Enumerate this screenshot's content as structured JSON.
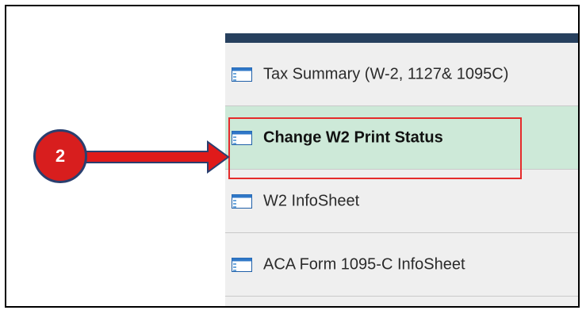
{
  "callout": {
    "step_number": "2"
  },
  "menu": {
    "items": [
      {
        "label": "Tax Summary (W-2, 1127& 1095C)",
        "icon": "page-list-icon",
        "selected": false
      },
      {
        "label": "Change W2 Print Status",
        "icon": "page-list-icon",
        "selected": true
      },
      {
        "label": "W2 InfoSheet",
        "icon": "page-list-icon",
        "selected": false
      },
      {
        "label": "ACA Form 1095-C InfoSheet",
        "icon": "page-list-icon",
        "selected": false
      }
    ]
  },
  "colors": {
    "topbar": "#27405e",
    "selected_bg": "#cde9d8",
    "item_bg": "#efefef",
    "highlight": "#e52b2b",
    "callout_fill": "#d81e1e",
    "callout_border": "#2a3f6f",
    "arrow": "#e01a1a"
  }
}
